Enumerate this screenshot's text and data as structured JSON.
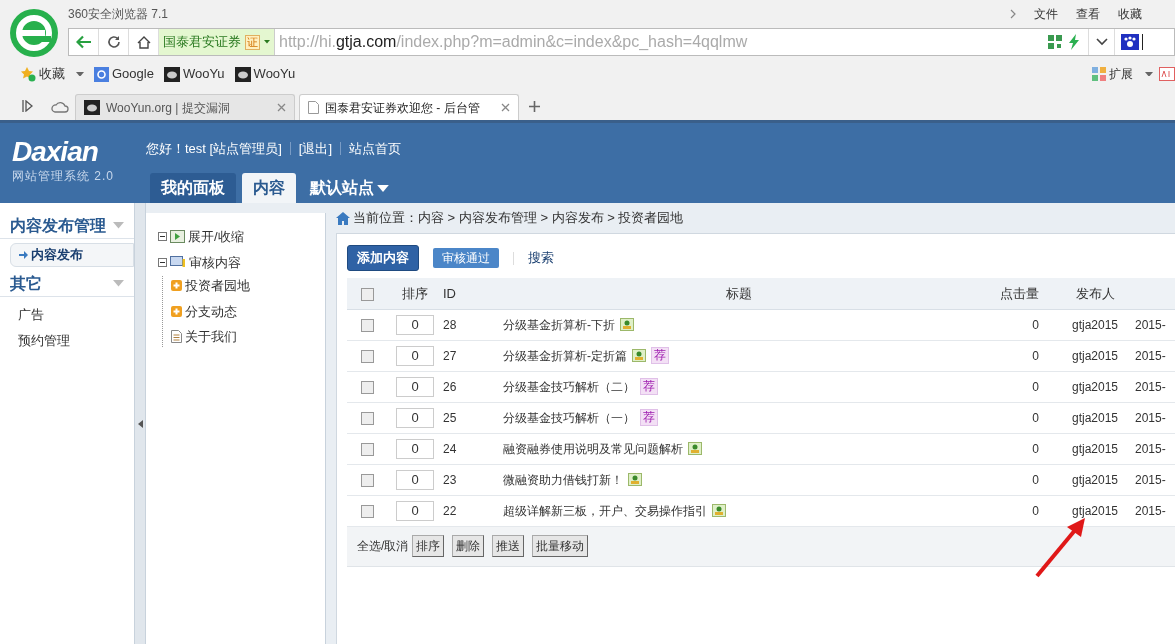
{
  "browser": {
    "title": "360安全浏览器 7.1",
    "menu": [
      "文件",
      "查看",
      "收藏"
    ],
    "security_label": "国泰君安证券",
    "security_badge": "证",
    "url": {
      "prefix": "http://hi.",
      "domain": "gtja.com",
      "rest": "/index.php?m=admin&c=index&pc_hash=4qqlmw"
    },
    "bookmarks": [
      {
        "kind": "favorites",
        "label": "收藏"
      },
      {
        "kind": "google",
        "label": "Google"
      },
      {
        "kind": "wooyun",
        "label": "WooYu"
      },
      {
        "kind": "wooyun",
        "label": "WooYu"
      }
    ],
    "extensions_label": "扩展",
    "tabs": [
      {
        "title": "WooYun.org | 提交漏洞",
        "kind": "wooyun",
        "selected": false
      },
      {
        "title": "国泰君安证券欢迎您 - 后台管",
        "kind": "page",
        "selected": true
      }
    ]
  },
  "header": {
    "logo": "Daxian",
    "subtitle": "网站管理系统 2.0",
    "greeting": "您好！test [站点管理员]",
    "logout": "[退出]",
    "home": "站点首页",
    "nav": [
      {
        "label": "我的面板",
        "selected": false
      },
      {
        "label": "内容",
        "selected": true
      }
    ],
    "site_menu": "默认站点"
  },
  "sidebar": {
    "sections": [
      {
        "title": "内容发布管理",
        "items": [
          {
            "label": "内容发布",
            "selected": true
          }
        ]
      },
      {
        "title": "其它",
        "items": [
          {
            "label": "广告",
            "selected": false
          },
          {
            "label": "预约管理",
            "selected": false
          }
        ]
      }
    ]
  },
  "tree": {
    "toggle": "展开/收缩",
    "root": {
      "label": "审核内容",
      "children": [
        {
          "label": "投资者园地",
          "kind": "category"
        },
        {
          "label": "分支动态",
          "kind": "category"
        },
        {
          "label": "关于我们",
          "kind": "page"
        }
      ]
    }
  },
  "breadcrumb": "当前位置：内容 > 内容发布管理 > 内容发布 > 投资者园地",
  "toolbar": {
    "add": "添加内容",
    "approve": "审核通过",
    "search": "搜索"
  },
  "table": {
    "select_all_checked": false,
    "columns": [
      "排序",
      "ID",
      "标题",
      "点击量",
      "发布人"
    ],
    "rows": [
      {
        "checked": false,
        "order": "0",
        "id": "28",
        "title": "分级基金折算析-下折",
        "image": true,
        "badge": "",
        "hits": "0",
        "author": "gtja2015",
        "date": "2015-"
      },
      {
        "checked": false,
        "order": "0",
        "id": "27",
        "title": "分级基金折算析-定折篇",
        "image": true,
        "badge": "荐",
        "hits": "0",
        "author": "gtja2015",
        "date": "2015-"
      },
      {
        "checked": false,
        "order": "0",
        "id": "26",
        "title": "分级基金技巧解析（二）",
        "image": false,
        "badge": "荐",
        "hits": "0",
        "author": "gtja2015",
        "date": "2015-"
      },
      {
        "checked": false,
        "order": "0",
        "id": "25",
        "title": "分级基金技巧解析（一）",
        "image": false,
        "badge": "荐",
        "hits": "0",
        "author": "gtja2015",
        "date": "2015-"
      },
      {
        "checked": false,
        "order": "0",
        "id": "24",
        "title": "融资融券使用说明及常见问题解析",
        "image": true,
        "badge": "",
        "hits": "0",
        "author": "gtja2015",
        "date": "2015-"
      },
      {
        "checked": false,
        "order": "0",
        "id": "23",
        "title": "微融资助力借钱打新！",
        "image": true,
        "badge": "",
        "hits": "0",
        "author": "gtja2015",
        "date": "2015-"
      },
      {
        "checked": false,
        "order": "0",
        "id": "22",
        "title": "超级详解新三板，开户、交易操作指引",
        "image": true,
        "badge": "",
        "hits": "0",
        "author": "gtja2015",
        "date": "2015-"
      }
    ],
    "select_all": "全选/取消",
    "actions": [
      "排序",
      "删除",
      "推送",
      "批量移动"
    ]
  }
}
